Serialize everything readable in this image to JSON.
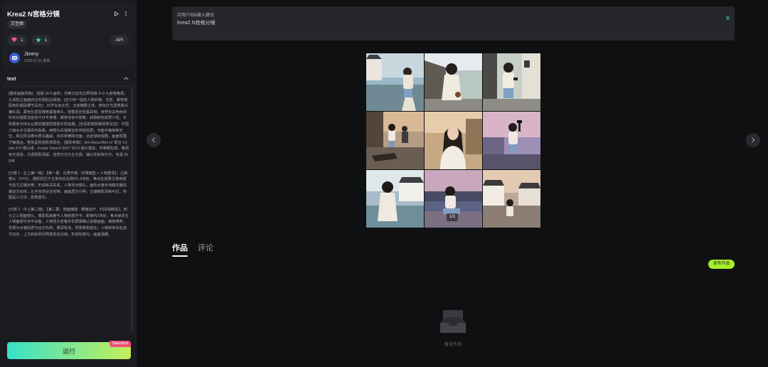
{
  "app": {
    "title": "Krea2 N宫格分镜",
    "tag": "文生图",
    "likes": "1",
    "favorites": "1",
    "api_label": "API"
  },
  "user": {
    "name": "Jimmy",
    "date": "2026.07.02 更新"
  },
  "text_panel": {
    "header": "text",
    "prompt": "[整体画面风格]：竖版 16:9 画布，均等分割无边界拼接 3×3 九宫格格局，九块独立画面四边无隙贴合相接；[全片统一固定人物外貌、东签、服饰搭配色彩额段细节设定]：20岁东亚女性，五官精致立体，家色灯光透亮柔白偏红润，黑色长直发微卷垂落肩头，侧额发丝轻垂耳侧，身穿米白色休闲针织衫搭配浅蓝色牛仔半身裙，脚穿浅色平底鞋，斜跨棕色皮质小包，手持黑色手持云台稳定器搭配智能手机拍摄；[全段剪辑剪辑场景设定]：中国江南水乡古镇青石板路，两侧为白墙黛瓦的传统民居，河面平静倒映天空，岸边停泊着木质乌篷船，石拱桥横跨河面，远处绿树成荫，画面氛围宁静悠远，整体呈现电影感调色。[摄影参数]：Arri Alexa Mini LF 配合 Cooke S7/i 镜头组，Kodak Vision3 500T 5219 胶片模拟，中等颗粒感，暖调色光渲染，冷调阴影保留，自然日光为主光源，辅以反射板补光，色温 5600K\n\n[分镜 1 - 左上第一格]：【第一幕：近景开篇 · 环境铺垫 + 人物登场】；过肩镜头（OTS），摄影机位于主角身后右侧约1.5米处，焦点在前景主角肩部与后方古镇全景，形成纵深关系，人物背对镜头，面向水巷手持稳定器拍摄远方石桥，左手自然扶住包带，画面层次分明，古镇倒影清晰可见，构图呈三分法，前景虚化。\n\n[分镜 2 - 中上第二格]：【第二幕：侧面铺垫 · 细微动作、时间线推进】；四分之三侧面镜头，摄影机高度与人物肩部齐平，距离约2米处，焦点锁定在人物面部与手中设备，人物低头查看手机屏幕确认拍摄画面，嘴角带笑，背景为水巷民居与远方石桥，景深较浅，背景柔和虚化；人物转身向右前方迈步，上方斜射阳光照亮发丝边缘，形成轮廓光，画面温暖。"
  },
  "run": {
    "label": "运行",
    "badge": "Standard"
  },
  "prompt_box": {
    "label": "应用介绍&输入建议",
    "value": "Krea2 N宫格分镜"
  },
  "gallery": {
    "counter": "1/1",
    "scenes": [
      "canal-standing",
      "alley-back",
      "street-phone",
      "river-photographer",
      "portrait-center",
      "sunset-camera",
      "boat-back",
      "dusk-sitting",
      "village-view"
    ]
  },
  "tabs": {
    "works": "作品",
    "comments": "评论"
  },
  "publish": {
    "label": "发布作品"
  },
  "empty_state": {
    "label": "暂无作品"
  },
  "colors": {
    "accent": "#a7ef2d",
    "run_gradient": [
      "#38e0c9",
      "#c4ee5a"
    ],
    "badge": "#ef4f7a"
  }
}
